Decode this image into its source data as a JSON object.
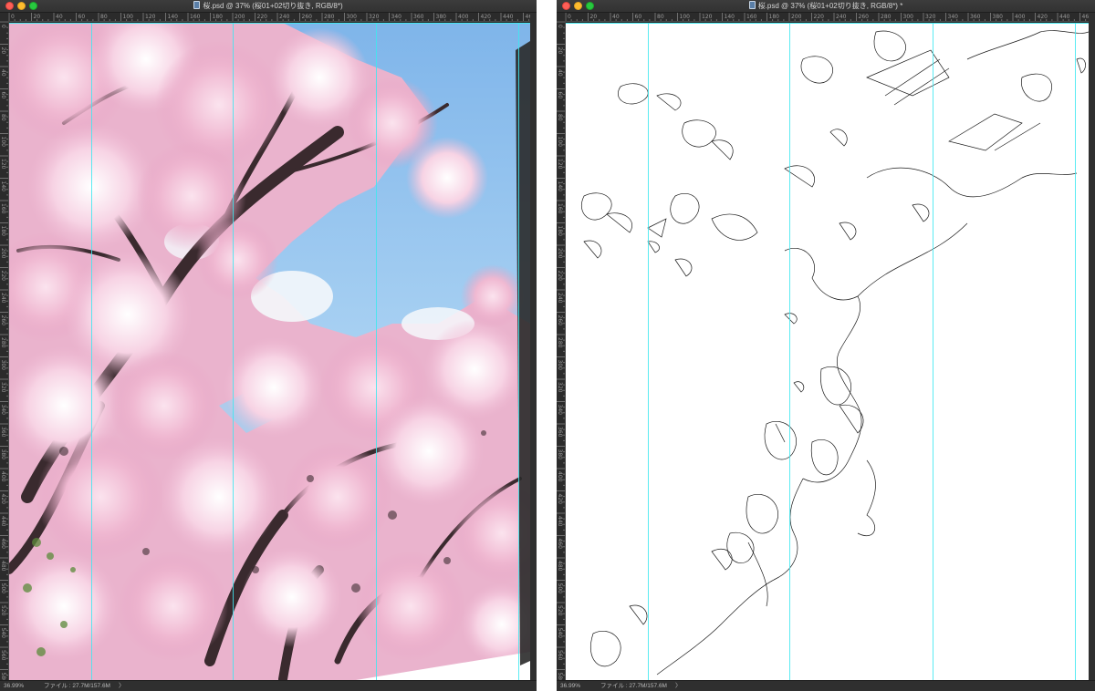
{
  "windows": [
    {
      "title": "桜.psd @ 37% (桜01+02切り抜き, RGB/8*)",
      "zoom": "36.99%",
      "file_info": "ファイル : 27.7M/157.6M",
      "info_arrow": "〉",
      "layer": "cherry blossom photo with sky"
    },
    {
      "title": "桜.psd @ 37% (桜01+02切り抜き, RGB/8*) *",
      "zoom": "36.99%",
      "file_info": "ファイル : 27.7M/157.6M",
      "info_arrow": "〉",
      "layer": "edge line trace on white"
    }
  ],
  "ruler": {
    "top_labels": [
      "0",
      "20",
      "40",
      "60",
      "80",
      "100",
      "120",
      "140",
      "160",
      "180",
      "200",
      "220",
      "240",
      "260",
      "280",
      "300",
      "320",
      "340",
      "360",
      "380",
      "400",
      "420",
      "440",
      "46"
    ],
    "left_labels": [
      "0",
      "20",
      "40",
      "60",
      "80",
      "100",
      "120",
      "140",
      "160",
      "180",
      "200",
      "220",
      "240",
      "260",
      "280",
      "300",
      "320",
      "340",
      "360",
      "380",
      "400",
      "420",
      "440",
      "460",
      "480",
      "500",
      "520",
      "540",
      "560",
      "580"
    ]
  },
  "colors": {
    "guide": "#3ee8f0",
    "sky": "#8ec2ec",
    "blossom": "#f4c8dd",
    "branch": "#3a2a2e",
    "chrome": "#2a2a2a"
  }
}
